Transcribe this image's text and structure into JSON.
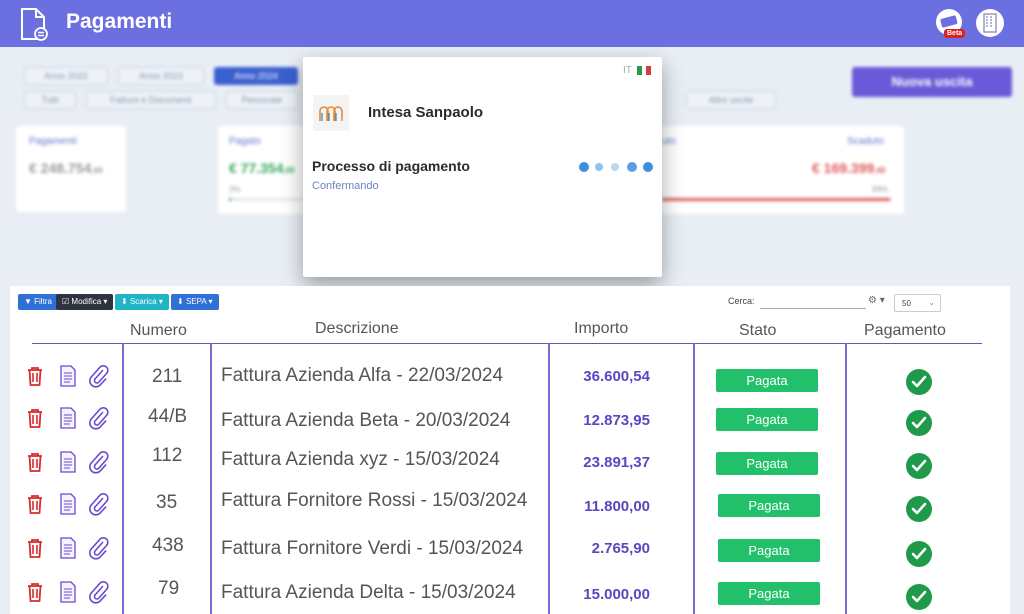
{
  "header": {
    "title": "Pagamenti",
    "beta_label": "Beta"
  },
  "background": {
    "year_tabs": [
      "Anno 2022",
      "Anno 2023",
      "Anno 2024"
    ],
    "filter_tabs": [
      "Tutti",
      "Fatture e Documenti",
      "Personale",
      "Altre uscite"
    ],
    "new_button": "Nuova uscita",
    "cards": {
      "pagamenti": {
        "label": "Pagamenti",
        "value": "€ 248.754",
        "decimals": ",44"
      },
      "pagato": {
        "label": "Pagato",
        "value": "€ 77.354",
        "decimals": ",00",
        "percent": "3%",
        "fill": 0.03
      },
      "scaduto": {
        "label": "Scaduto",
        "value": "€ 169.399",
        "decimals": ",40",
        "percent": "99%",
        "fill": 0.99
      },
      "partial_label": "uto"
    }
  },
  "modal": {
    "lang": "IT",
    "bank_name": "Intesa Sanpaolo",
    "process_title": "Processo di pagamento",
    "process_status": "Confermando"
  },
  "toolbar": {
    "filter": "Filtra",
    "modify": "Modifica",
    "download": "Scarica",
    "sepa": "SEPA",
    "search_label": "Cerca:",
    "per_page": "50"
  },
  "table": {
    "headers": {
      "numero": "Numero",
      "descrizione": "Descrizione",
      "importo": "Importo",
      "stato": "Stato",
      "pagamento": "Pagamento"
    },
    "rows": [
      {
        "numero": "211",
        "descrizione": "Fattura Azienda Alfa - 22/03/2024",
        "importo": "36.600,54",
        "stato": "Pagata"
      },
      {
        "numero": "44/B",
        "descrizione": "Fattura Azienda Beta - 20/03/2024",
        "importo": "12.873,95",
        "stato": "Pagata"
      },
      {
        "numero": "112",
        "descrizione": "Fattura Azienda xyz - 15/03/2024",
        "importo": "23.891,37",
        "stato": "Pagata"
      },
      {
        "numero": "35",
        "descrizione": "Fattura Fornitore Rossi - 15/03/2024",
        "importo": "11.800,00",
        "stato": "Pagata"
      },
      {
        "numero": "438",
        "descrizione": "Fattura Fornitore Verdi - 15/03/2024",
        "importo": "2.765,90",
        "stato": "Pagata"
      },
      {
        "numero": "79",
        "descrizione": "Fattura Azienda Delta - 15/03/2024",
        "importo": "15.000,00",
        "stato": "Pagata"
      }
    ]
  },
  "colors": {
    "header_bg": "#6b6fe0",
    "accent": "#5848c0",
    "success": "#22c06a",
    "danger": "#d92b2b"
  }
}
